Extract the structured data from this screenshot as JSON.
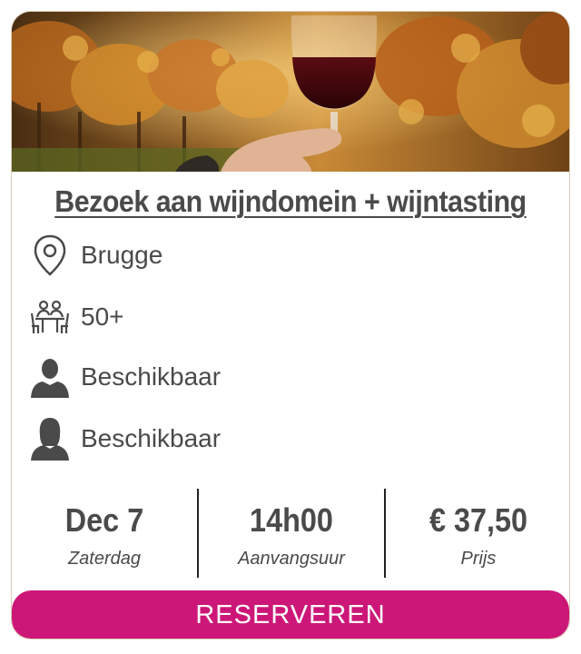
{
  "event": {
    "title": "Bezoek aan wijndomein + wijntasting",
    "image_alt_icon": "wine-glass-vineyard-photo"
  },
  "details": {
    "location": "Brugge",
    "age_group": "50+",
    "male_availability": "Beschikbaar",
    "female_availability": "Beschikbaar"
  },
  "facts": {
    "date": "Dec 7",
    "day": "Zaterdag",
    "time": "14h00",
    "time_label": "Aanvangsuur",
    "price": "€ 37,50",
    "price_label": "Prijs"
  },
  "actions": {
    "reserve_label": "RESERVEREN"
  },
  "colors": {
    "accent": "#cc1778",
    "text": "#4a4a4a",
    "border": "#d9c9b3"
  }
}
